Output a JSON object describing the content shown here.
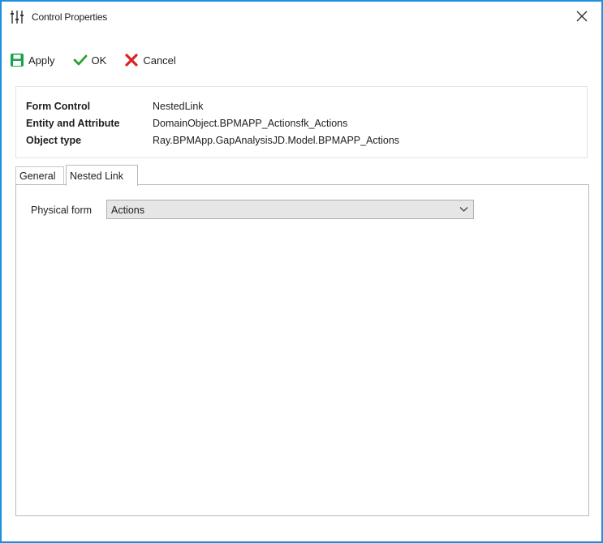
{
  "window": {
    "title": "Control Properties",
    "title_icon": "sliders-icon",
    "close_icon": "close-icon"
  },
  "toolbar": {
    "apply_label": "Apply",
    "ok_label": "OK",
    "cancel_label": "Cancel",
    "apply_icon": "save-icon",
    "ok_icon": "checkmark-icon",
    "cancel_icon": "x-icon"
  },
  "info": {
    "rows": [
      {
        "label": "Form Control",
        "value": "NestedLink"
      },
      {
        "label": "Entity and Attribute",
        "value": "DomainObject.BPMAPP_Actionsfk_Actions"
      },
      {
        "label": "Object type",
        "value": "Ray.BPMApp.GapAnalysisJD.Model.BPMAPP_Actions"
      }
    ]
  },
  "tabs": [
    {
      "label": "General",
      "active": false
    },
    {
      "label": "Nested Link",
      "active": true
    }
  ],
  "nested_link": {
    "physical_form_label": "Physical form",
    "physical_form_value": "Actions"
  },
  "colors": {
    "window_border": "#1b8fe0",
    "save_green": "#17a34a",
    "ok_green": "#2e9d2e",
    "cancel_red": "#e02020"
  }
}
